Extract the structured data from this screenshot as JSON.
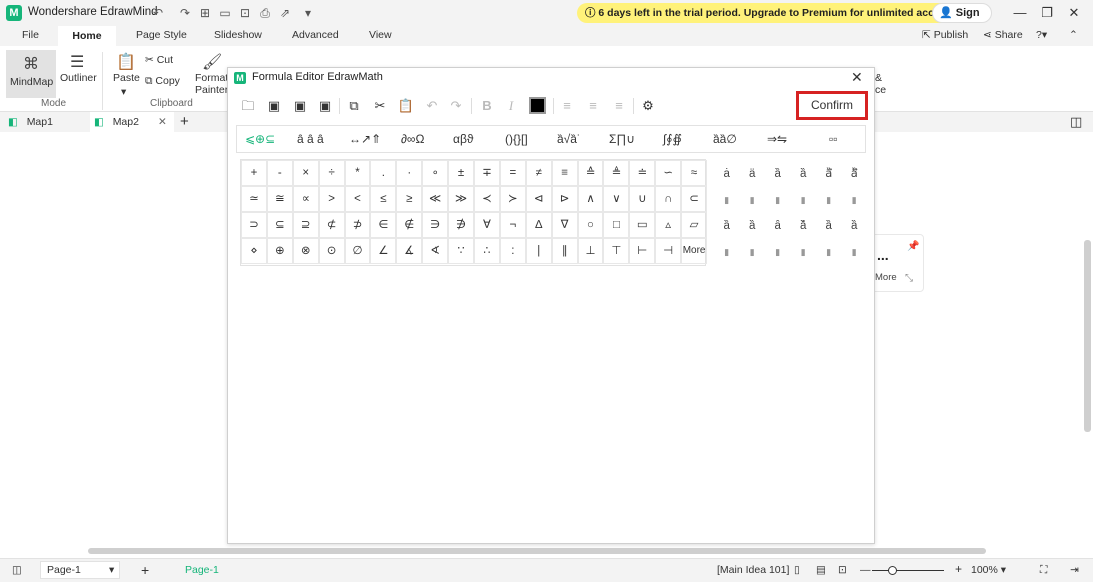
{
  "app": {
    "title": "Wondershare EdrawMind",
    "trial_banner": "6 days left in the trial period. Upgrade to Premium for unlimited access.",
    "sign_in": "Sign In",
    "logo_glyph": "M"
  },
  "menu": {
    "items": [
      "File",
      "Home",
      "Page Style",
      "Slideshow",
      "Advanced",
      "View"
    ],
    "publish": "Publish",
    "share": "Share"
  },
  "ribbon": {
    "mindmap": "MindMap",
    "outliner": "Outliner",
    "mode_group": "Mode",
    "paste": "Paste",
    "cut": "Cut",
    "copy": "Copy",
    "format_painter_1": "Format",
    "format_painter_2": "Painter",
    "clipboard_group": "Clipboard",
    "right_text_1": "&",
    "right_text_2": "ce"
  },
  "doc_tabs": [
    "Map1",
    "Map2"
  ],
  "dialog": {
    "title": "Formula Editor EdrawMath",
    "confirm": "Confirm",
    "categories": [
      "⩽⊕⊆",
      "ȃ ȃ ȃ",
      "↔↗⇑",
      "∂∞Ω",
      "αβϑ",
      "(){}[]",
      "ȁ√ȁ˙",
      "Σ∏∪",
      "∫∮∯",
      "ȁȁ∅",
      "⇒⇋",
      "▫▫"
    ],
    "symbols": [
      [
        "+",
        "-",
        "×",
        "÷",
        "*",
        ".",
        "·",
        "∘",
        "±",
        "∓",
        "=",
        "≠",
        "≡",
        "≙",
        "≜",
        "≐",
        "∽",
        "≈"
      ],
      [
        "≃",
        "≅",
        "∝",
        ">",
        "<",
        "≤",
        "≥",
        "≪",
        "≫",
        "≺",
        "≻",
        "⊲",
        "⊳",
        "∧",
        "∨",
        "∪",
        "∩",
        "⊂"
      ],
      [
        "⊃",
        "⊆",
        "⊇",
        "⊄",
        "⊅",
        "∈",
        "∉",
        "∋",
        "∌",
        "∀",
        "¬",
        "∆",
        "∇",
        "○",
        "□",
        "▭",
        "▵",
        "▱"
      ],
      [
        "⋄",
        "⊕",
        "⊗",
        "⊙",
        "∅",
        "∠",
        "∡",
        "∢",
        "∵",
        "∴",
        ":",
        "|",
        "∥",
        "⊥",
        "⊤",
        "⊢",
        "⊣",
        "More"
      ]
    ],
    "accents": [
      [
        "ȧ",
        "ä",
        "ȁ",
        "ȁ",
        "ȁ⃗",
        "ȁ⃡"
      ],
      [
        "▮",
        "▮",
        "▮",
        "▮",
        "▮",
        "▮"
      ],
      [
        "ȁ",
        "ȁ",
        "ȃ",
        "ȁ̌",
        "ȁ",
        "ȁ"
      ],
      [
        "▮",
        "▮",
        "▮",
        "▮",
        "▮",
        "▮"
      ]
    ]
  },
  "side_panel": {
    "dots": "...",
    "more": "More"
  },
  "status": {
    "page_select": "Page-1",
    "page_tab": "Page-1",
    "main_idea": "[Main Idea 101]",
    "zoom": "100%"
  },
  "colors": {
    "brand": "#16b57a",
    "highlight": "#d62222",
    "trial": "#fff27a"
  }
}
